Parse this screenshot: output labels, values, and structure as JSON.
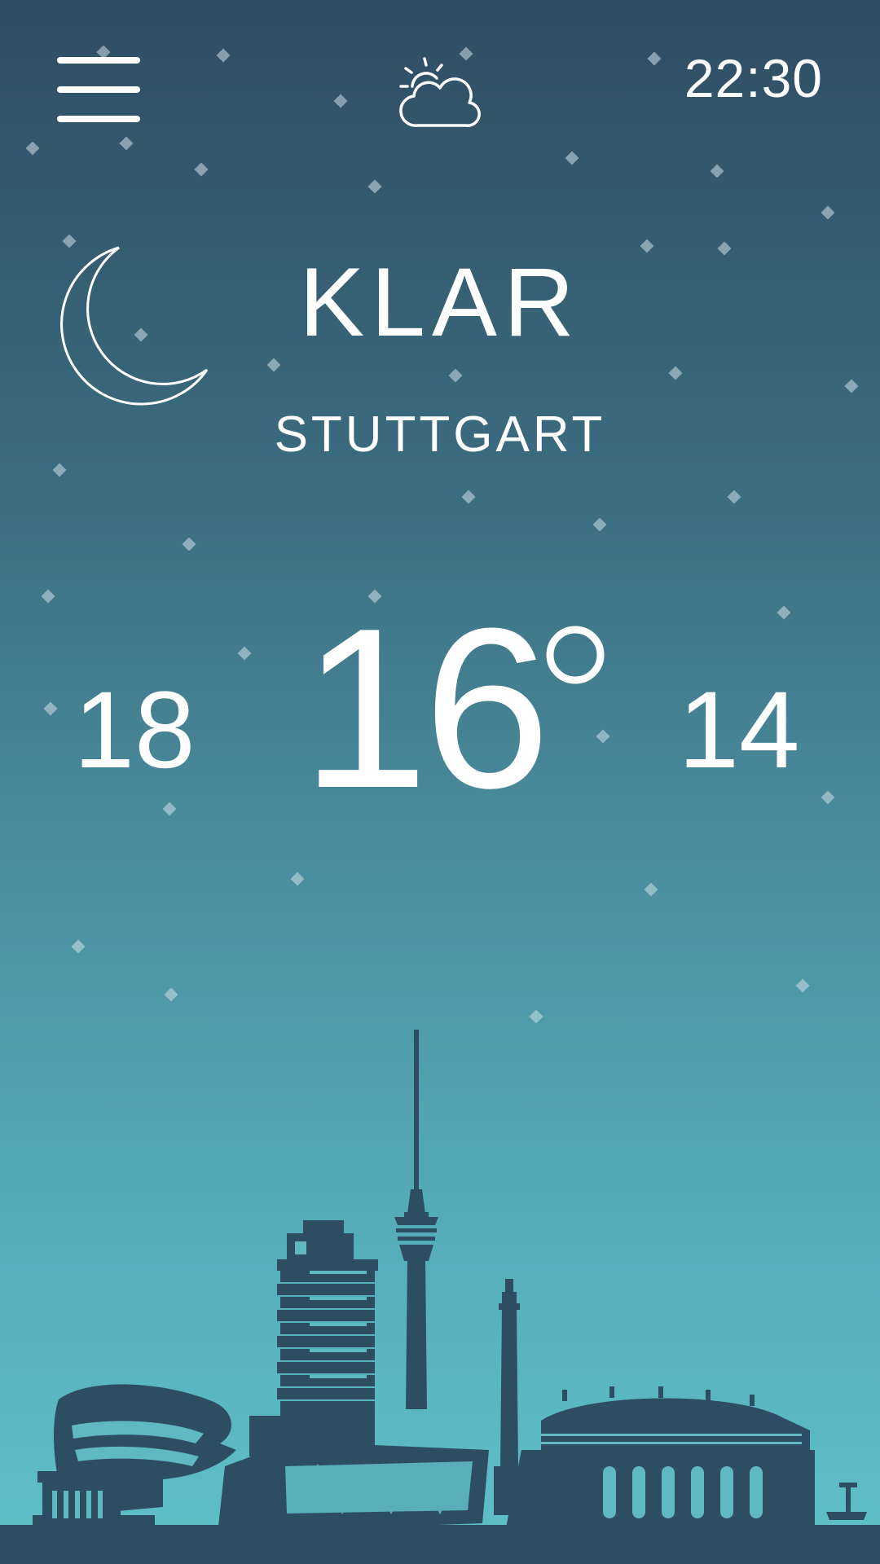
{
  "header": {
    "menu_icon": "hamburger-menu-icon",
    "weather_icon": "partly-cloudy-icon",
    "time": "22:30"
  },
  "current": {
    "condition_icon": "crescent-moon-icon",
    "condition": "KLAR",
    "city": "STUTTGART",
    "temperature": "16",
    "high": "18",
    "low": "14"
  },
  "illustration": {
    "type": "stuttgart-skyline-silhouette",
    "color": "#2d4d62"
  },
  "colors": {
    "sky_top": "#2f4d62",
    "sky_bottom": "#5fc0c8",
    "text": "#ffffff"
  }
}
